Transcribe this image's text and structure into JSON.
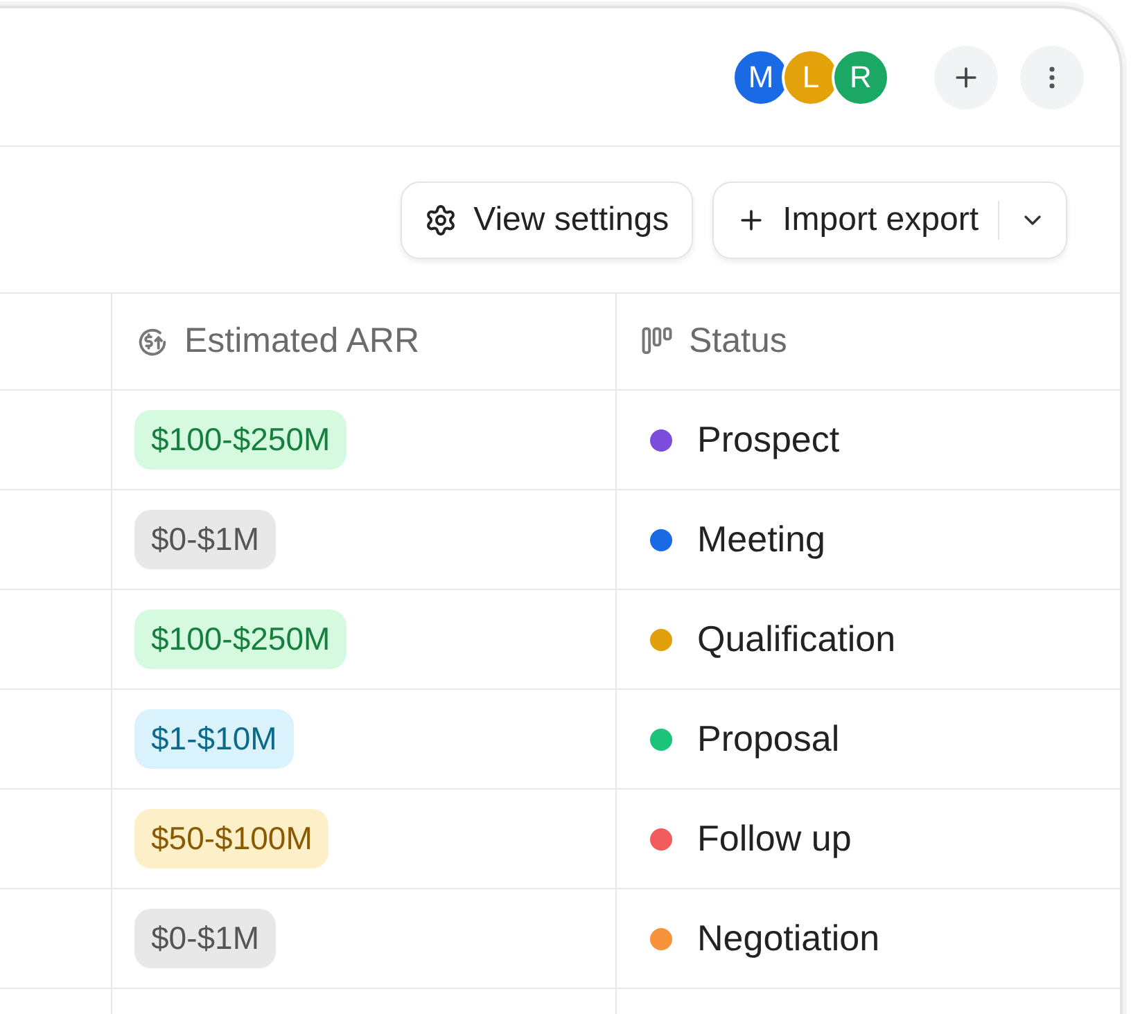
{
  "avatars": [
    {
      "initial": "M",
      "color": "#1a6ae6"
    },
    {
      "initial": "L",
      "color": "#e3a20a"
    },
    {
      "initial": "R",
      "color": "#1aa864"
    }
  ],
  "toolbar": {
    "view_settings": "View settings",
    "import_export": "Import export"
  },
  "table": {
    "columns": [
      {
        "label": "Estimated ARR",
        "kind": "currency"
      },
      {
        "label": "Status",
        "kind": "status"
      }
    ],
    "rows": [
      {
        "arr": {
          "text": "$100-$250M",
          "color": "#15803d"
        },
        "status": {
          "text": "Prospect",
          "color": "#7c4ddc"
        }
      },
      {
        "arr": {
          "text": "$0-$1M",
          "color": "#555555"
        },
        "status": {
          "text": "Meeting",
          "color": "#1a6ae6"
        }
      },
      {
        "arr": {
          "text": "$100-$250M",
          "color": "#15803d"
        },
        "status": {
          "text": "Qualification",
          "color": "#e0a00c"
        }
      },
      {
        "arr": {
          "text": "$1-$10M",
          "color": "#0e6a8a"
        },
        "status": {
          "text": "Proposal",
          "color": "#1cc47a"
        }
      },
      {
        "arr": {
          "text": "$50-$100M",
          "color": "#8a5a00"
        },
        "status": {
          "text": "Follow up",
          "color": "#f25c5c"
        }
      },
      {
        "arr": {
          "text": "$0-$1M",
          "color": "#555555"
        },
        "status": {
          "text": "Negotiation",
          "color": "#f7913b"
        }
      }
    ]
  }
}
